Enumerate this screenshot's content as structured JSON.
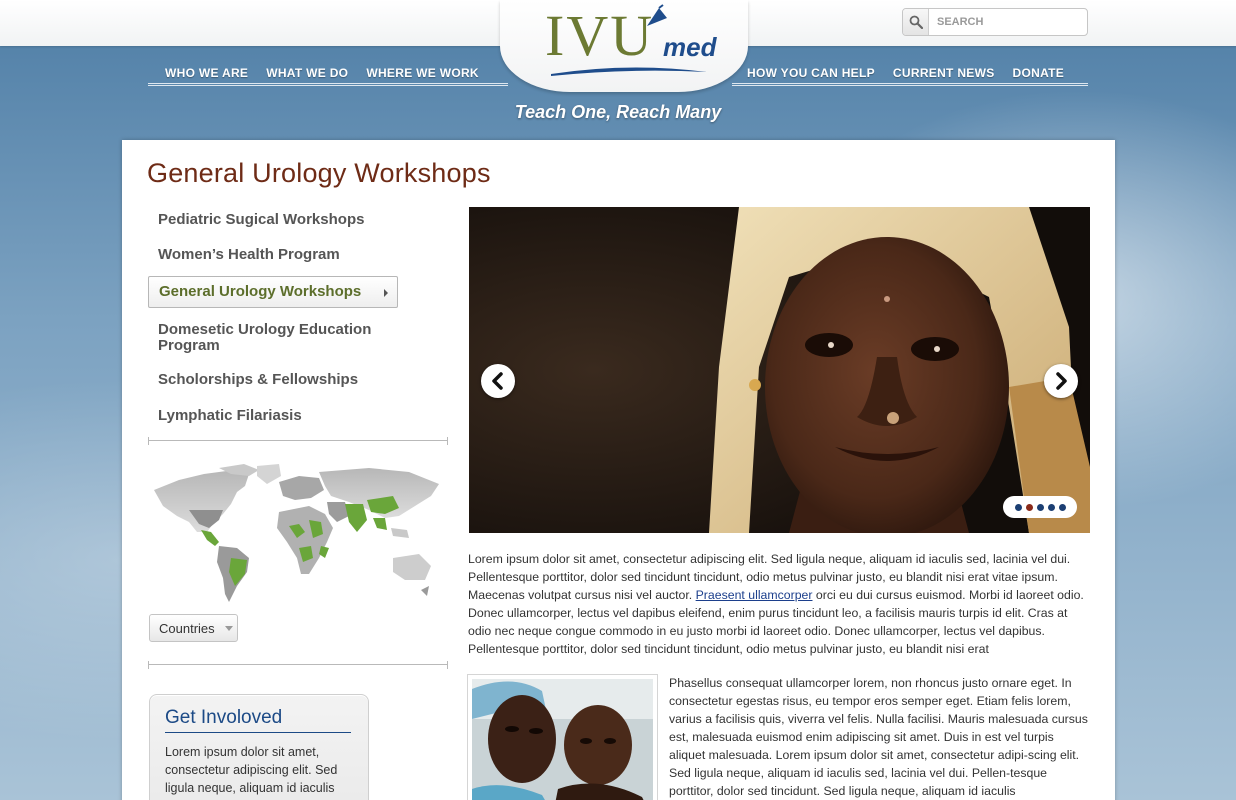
{
  "header": {
    "logo_text": "IVU",
    "logo_suffix": "med",
    "tagline": "Teach One, Reach Many",
    "search_placeholder": "SEARCH",
    "nav_left": [
      "WHO WE ARE",
      "WHAT WE DO",
      "WHERE WE WORK"
    ],
    "nav_right": [
      "HOW YOU CAN HELP",
      "CURRENT NEWS",
      "DONATE"
    ]
  },
  "page": {
    "title": "General Urology Workshops"
  },
  "sidebar": {
    "items": [
      {
        "label": "Pediatric Sugical Workshops",
        "active": false
      },
      {
        "label": "Women’s Health Program",
        "active": false
      },
      {
        "label": "General Urology Workshops",
        "active": true
      },
      {
        "label": "Domesetic Urology Education Program",
        "active": false
      },
      {
        "label": "Scholorships & Fellowships",
        "active": false
      },
      {
        "label": "Lymphatic Filariasis",
        "active": false
      }
    ],
    "countries_label": "Countries",
    "get_involved": {
      "title": "Get Involoved",
      "text": "Lorem ipsum dolor sit amet, consectetur adipiscing elit. Sed ligula neque, aliquam id iaculis"
    }
  },
  "slider": {
    "dot_count": 5,
    "active_dot": 1
  },
  "content": {
    "intro_before_link": "Lorem ipsum dolor sit amet, consectetur adipiscing elit. Sed ligula neque, aliquam id iaculis sed, lacinia vel dui. Pellentesque porttitor, dolor sed tincidunt tincidunt, odio metus pulvinar justo, eu blandit nisi erat vitae ipsum. Maecenas volutpat cursus nisi vel auctor. ",
    "intro_link": "Praesent ullamcorper",
    "intro_after_link": " orci eu dui cursus euismod. Morbi id laoreet odio. Donec ullamcorper, lectus vel dapibus eleifend, enim purus tincidunt leo, a facilisis mauris turpis id elit. Cras at odio nec neque congue commodo in eu justo morbi id laoreet odio. Donec ullamcorper, lectus vel dapibus. Pellentesque porttitor, dolor sed tincidunt tincidunt, odio metus pulvinar justo, eu blandit nisi erat",
    "body2": "Phasellus consequat ullamcorper lorem, non rhoncus justo ornare eget. In consectetur egestas risus, eu tempor eros semper eget. Etiam felis lorem, varius a facilisis quis, viverra vel felis. Nulla facilisi. Mauris malesuada cursus est, malesuada euismod enim adipiscing sit amet. Duis in est vel turpis aliquet malesuada. Lorem ipsum dolor sit amet, consectetur adipi-scing elit. Sed ligula neque, aliquam id iaculis sed, lacinia vel dui. Pellen-tesque porttitor, dolor sed tincidunt. Sed ligula neque, aliquam id iaculis"
  },
  "colors": {
    "title_brown": "#6e2b16",
    "logo_olive": "#6c7a33",
    "logo_blue": "#1f4d8c",
    "active_green": "#5c6e2b",
    "map_green": "#6aa63a",
    "link_blue": "#1c3f8c"
  }
}
